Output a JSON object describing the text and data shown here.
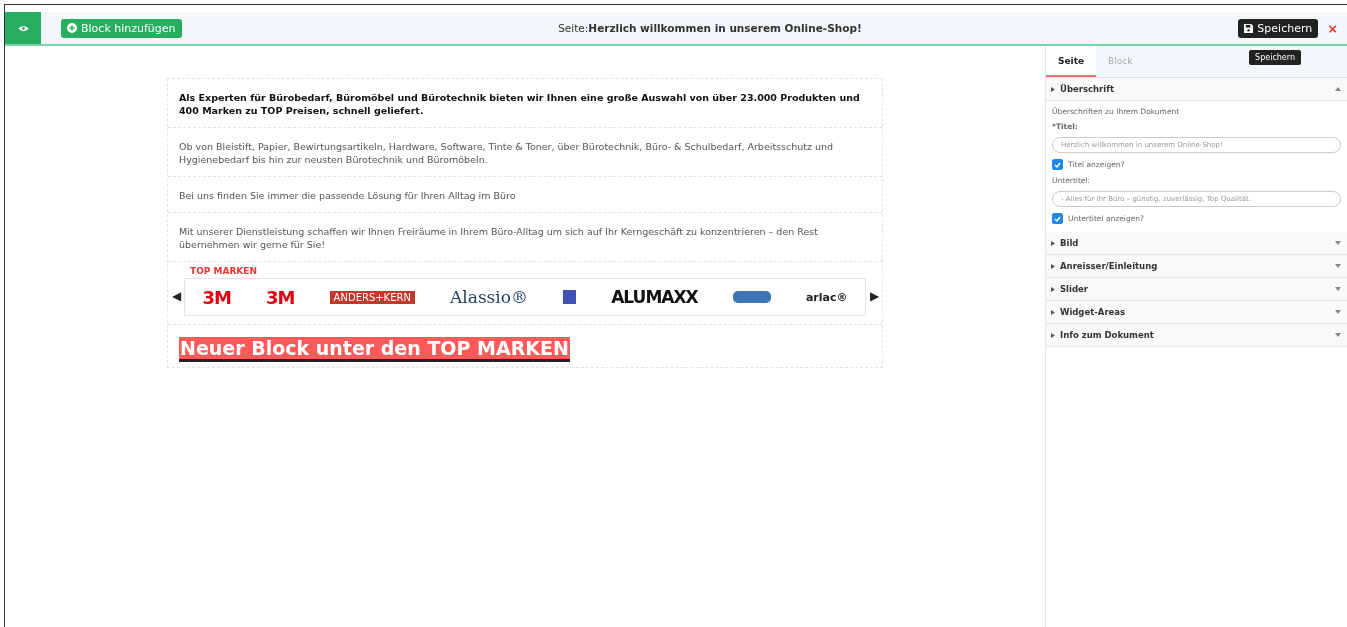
{
  "toolbar": {
    "add_button": "Block hinzufügen",
    "page_label": "Seite:",
    "page_title": "Herzlich willkommen in unserem Online-Shop!",
    "save_button": "Speichern",
    "tooltip": "Speichern",
    "close": "×"
  },
  "content": {
    "paragraphs": [
      {
        "text": "Als Experten für Bürobedarf, Büromöbel und Bürotechnik bieten wir Ihnen eine große Auswahl von über 23.000 Produkten und 400 Marken zu TOP Preisen, schnell geliefert.",
        "bold": true
      },
      {
        "text": "Ob von Bleistift, Papier, Bewirtungsartikeln, Hardware, Software, Tinte & Toner, über Bürotechnik, Büro- & Schulbedarf, Arbeitsschutz und Hygienebedarf bis hin zur neusten Bürotechnik und Büromöbeln.",
        "bold": false
      },
      {
        "text": "Bei uns finden Sie immer die passende Lösung für Ihren Alltag im Büro",
        "bold": false
      },
      {
        "text": "Mit unserer Dienstleistung schaffen wir Ihnen Freiräume in Ihrem Büro-Alltag um sich auf Ihr Kerngeschäft zu konzentrieren – den Rest übernehmen wir gerne für Sie!",
        "bold": false
      }
    ],
    "brands_title": "TOP MARKEN",
    "prev": "◀",
    "next": "▶",
    "brands": [
      {
        "kind": "red",
        "text": "3M"
      },
      {
        "kind": "red",
        "text": "3M"
      },
      {
        "kind": "boxed",
        "text": "ANDERS+KERN"
      },
      {
        "kind": "serif",
        "text": "Alassio®"
      },
      {
        "kind": "square"
      },
      {
        "kind": "black",
        "text": "ALUMAXX"
      },
      {
        "kind": "oval"
      },
      {
        "kind": "round",
        "text": "arlac®"
      }
    ],
    "new_block": "Neuer Block unter den TOP MARKEN"
  },
  "panel": {
    "tabs": [
      {
        "label": "Seite",
        "selected": true
      },
      {
        "label": "Block",
        "selected": false
      }
    ],
    "sections": [
      {
        "title": "Überschrift",
        "expanded": true
      },
      {
        "title": "Bild",
        "expanded": false
      },
      {
        "title": "Anreisser/Einleitung",
        "expanded": false
      },
      {
        "title": "Slider",
        "expanded": false
      },
      {
        "title": "Widget-Areas",
        "expanded": false
      },
      {
        "title": "Info zum Dokument",
        "expanded": false
      }
    ],
    "heading_form": {
      "hint": "Überschriften zu Ihrem Dokument",
      "title_label": "*Titel:",
      "title_value": "Herzlich willkommen in unserem Online-Shop!",
      "show_title": {
        "label": "Titel anzeigen?",
        "checked": true
      },
      "subtitle_label": "Untertitel:",
      "subtitle_value": "- Alles für Ihr Büro – günstig, zuverlässig, Top Qualität.",
      "show_subtitle": {
        "label": "Untertitel anzeigen?",
        "checked": true
      }
    }
  }
}
